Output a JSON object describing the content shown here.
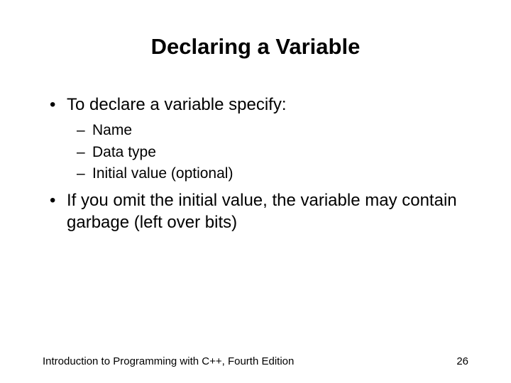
{
  "title": "Declaring a Variable",
  "bullets": {
    "b1": "To declare a variable specify:",
    "b1_subs": {
      "s1": "Name",
      "s2": "Data type",
      "s3": "Initial value (optional)"
    },
    "b2": "If you omit the initial value, the variable may contain garbage (left over bits)"
  },
  "footer": {
    "source": "Introduction to Programming with C++, Fourth Edition",
    "page": "26"
  }
}
